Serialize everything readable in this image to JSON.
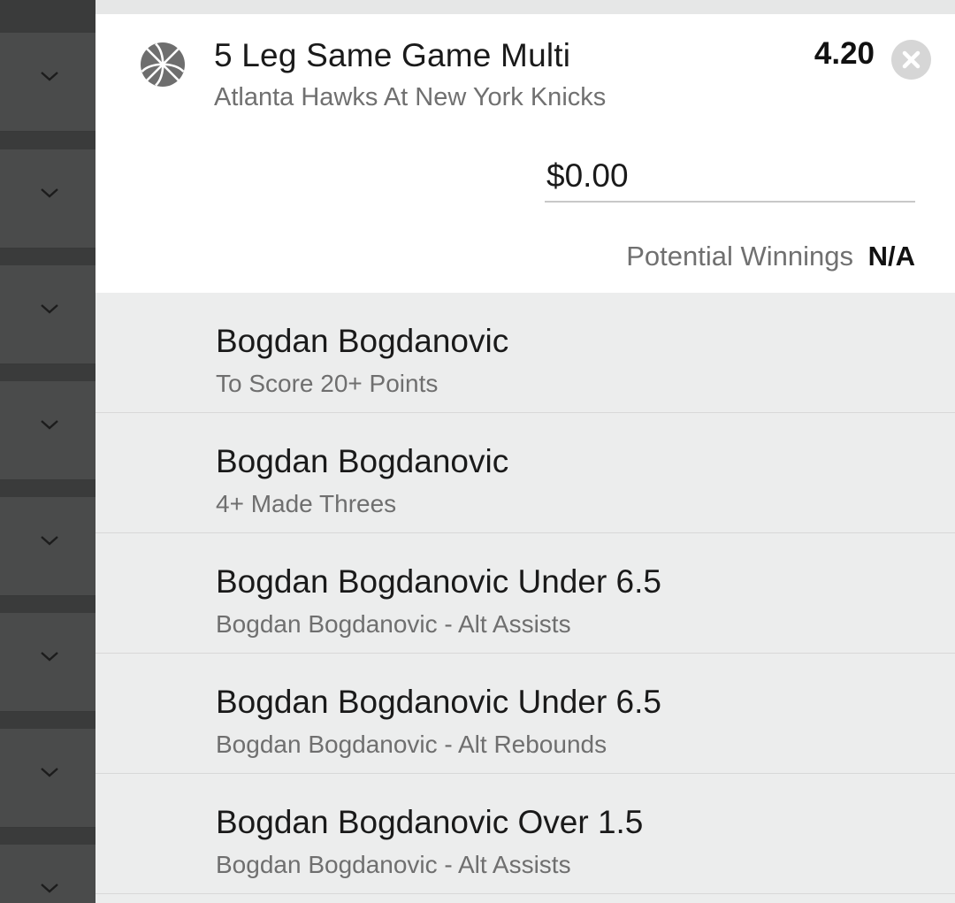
{
  "bet": {
    "title": "5 Leg Same Game Multi",
    "match": "Atlanta Hawks At New York Knicks",
    "odds": "4.20",
    "stake_value": "$0.00",
    "potential_winnings_label": "Potential Winnings",
    "potential_winnings_value": "N/A",
    "sport_icon": "basketball-icon",
    "close_icon": "close-icon"
  },
  "legs": [
    {
      "title": "Bogdan Bogdanovic",
      "market": "To Score 20+ Points"
    },
    {
      "title": "Bogdan Bogdanovic",
      "market": "4+ Made Threes"
    },
    {
      "title": "Bogdan Bogdanovic Under 6.5",
      "market": "Bogdan Bogdanovic - Alt Assists"
    },
    {
      "title": "Bogdan Bogdanovic Under 6.5",
      "market": "Bogdan Bogdanovic - Alt Rebounds"
    },
    {
      "title": "Bogdan Bogdanovic Over 1.5",
      "market": "Bogdan Bogdanovic - Alt Assists"
    }
  ],
  "sidebar": {
    "expand_icon": "chevron-down-icon",
    "row_count": 8
  },
  "colors": {
    "panel_background": "#eceded",
    "card_background": "#ffffff",
    "sidebar_background": "#4a4b4b",
    "muted_text": "#707070",
    "close_button": "#d6d6d6"
  }
}
